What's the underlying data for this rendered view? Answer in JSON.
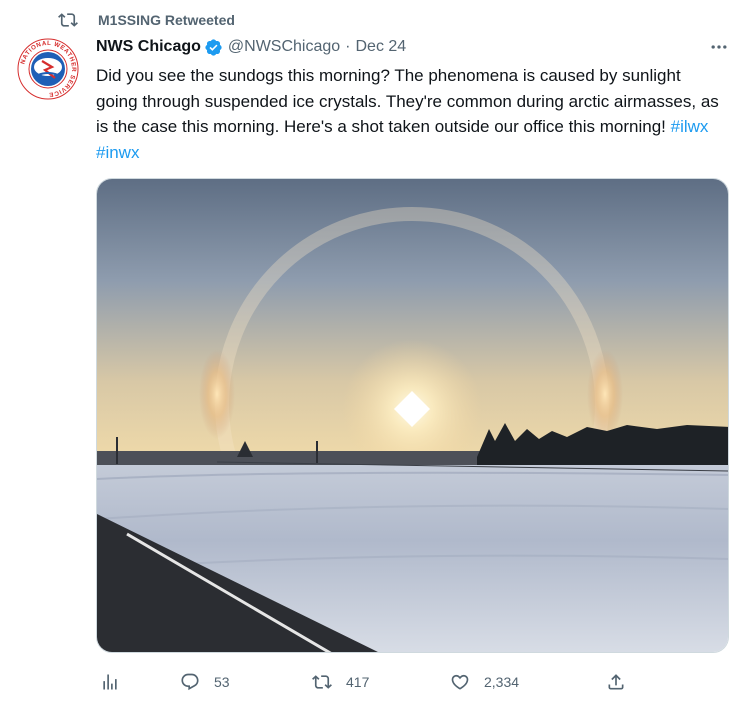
{
  "retweet": {
    "label": "M1SSING Retweeted",
    "icon": "retweet-icon"
  },
  "author": {
    "name": "NWS Chicago",
    "handle": "@NWSChicago",
    "separator": "·",
    "date": "Dec 24",
    "verified": true,
    "avatar_icon": "national-weather-service-logo",
    "avatar_text": "NATIONAL WEATHER SERVICE"
  },
  "tweet": {
    "text_plain": "Did you see the sundogs this morning? The phenomena is caused by sunlight going through suspended ice crystals. They're common during arctic airmasses, as is the case this morning. Here's a shot taken outside our office this morning!",
    "hashtags": [
      "#ilwx",
      "#inwx"
    ]
  },
  "actions": {
    "analytics_icon": "analytics-icon",
    "reply": {
      "icon": "reply-icon",
      "count": "53"
    },
    "retweet": {
      "icon": "retweet-icon",
      "count": "417"
    },
    "like": {
      "icon": "heart-icon",
      "count": "2,334"
    },
    "share_icon": "share-icon"
  },
  "colors": {
    "accent": "#1d9bf0",
    "muted": "#536471",
    "text": "#0f1419",
    "verified": "#1d9bf0"
  }
}
